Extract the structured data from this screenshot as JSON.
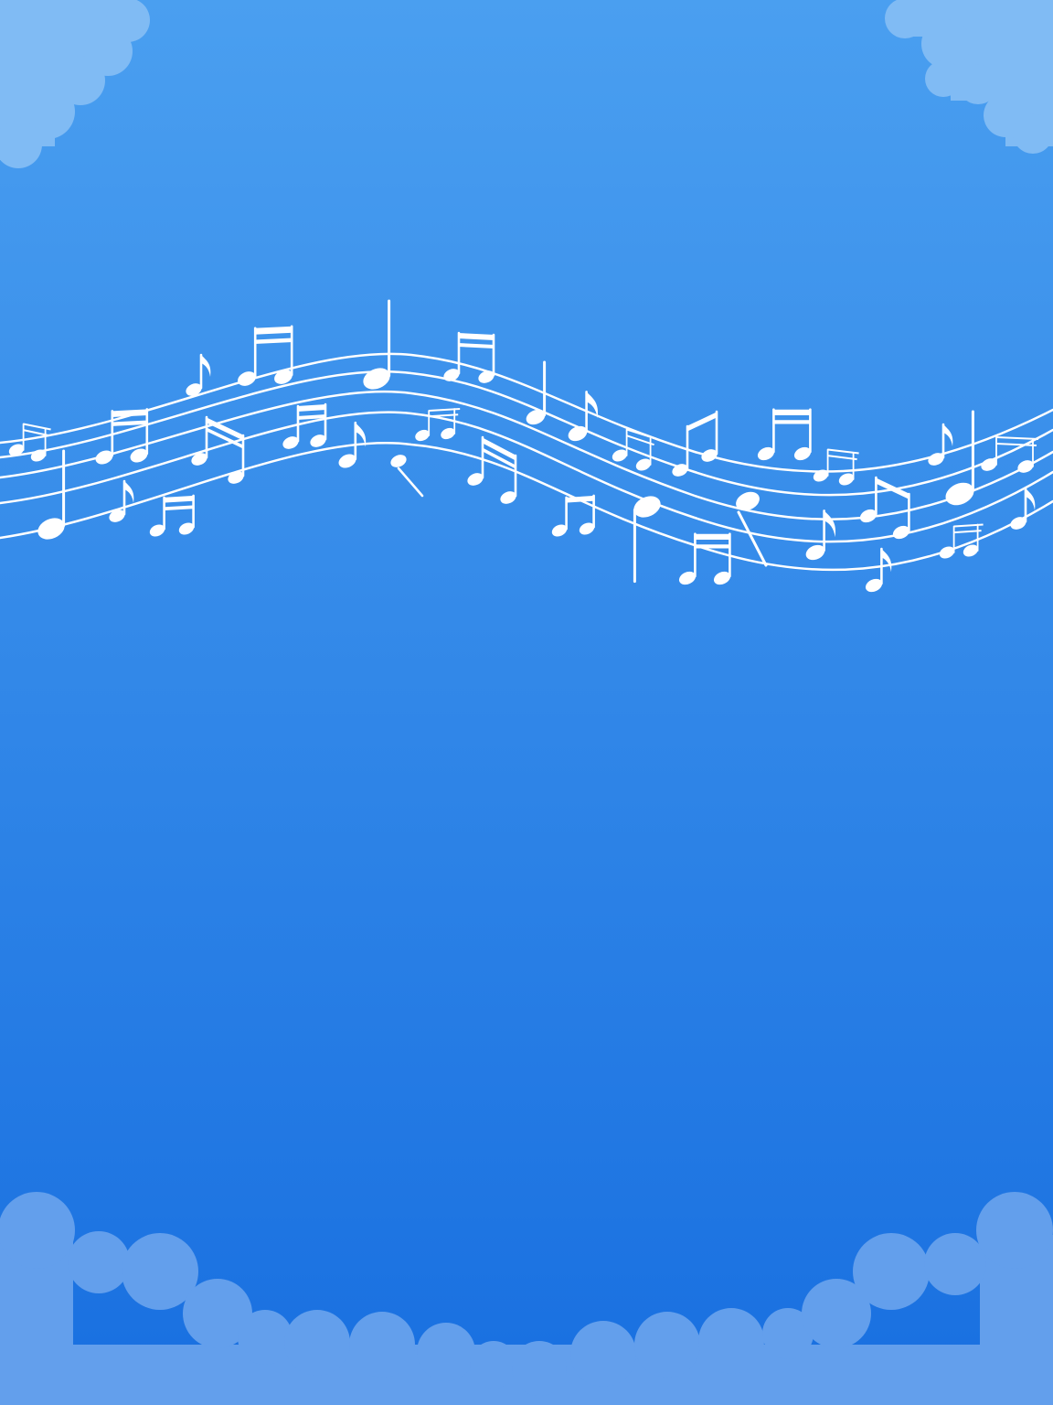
{
  "colors": {
    "sky_top": "#4a9ff0",
    "sky_bottom": "#186fe0",
    "cloud_top": "#80bbf4",
    "cloud_bottom": "#639fec",
    "ink": "#ffffff"
  },
  "icons": {
    "clouds": "cloud-icon",
    "staff": "music-staff-icon",
    "notes": "music-note-icon"
  }
}
